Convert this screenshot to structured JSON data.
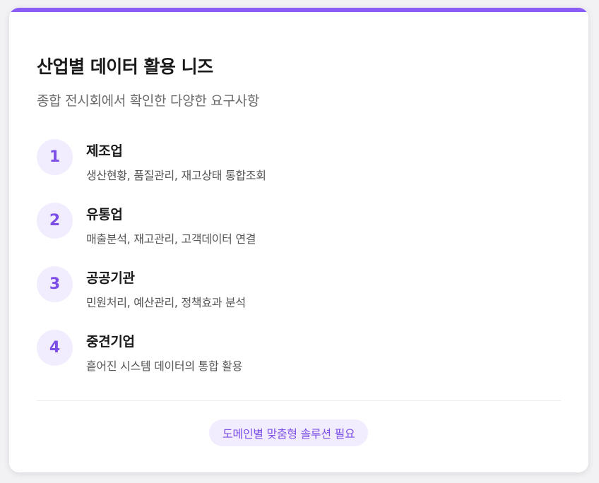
{
  "card": {
    "title": "산업별 데이터 활용 니즈",
    "subtitle": "종합 전시회에서 확인한 다양한 요구사항",
    "accent_color": "#8b5cf6"
  },
  "items": [
    {
      "number": "1",
      "title": "제조업",
      "desc": "생산현황, 품질관리, 재고상태 통합조회"
    },
    {
      "number": "2",
      "title": "유통업",
      "desc": "매출분석, 재고관리, 고객데이터 연결"
    },
    {
      "number": "3",
      "title": "공공기관",
      "desc": "민원처리, 예산관리, 정책효과 분석"
    },
    {
      "number": "4",
      "title": "중견기업",
      "desc": "흩어진 시스템 데이터의 통합 활용"
    }
  ],
  "footer": {
    "badge": "도메인별 맞춤형 솔루션 필요"
  }
}
